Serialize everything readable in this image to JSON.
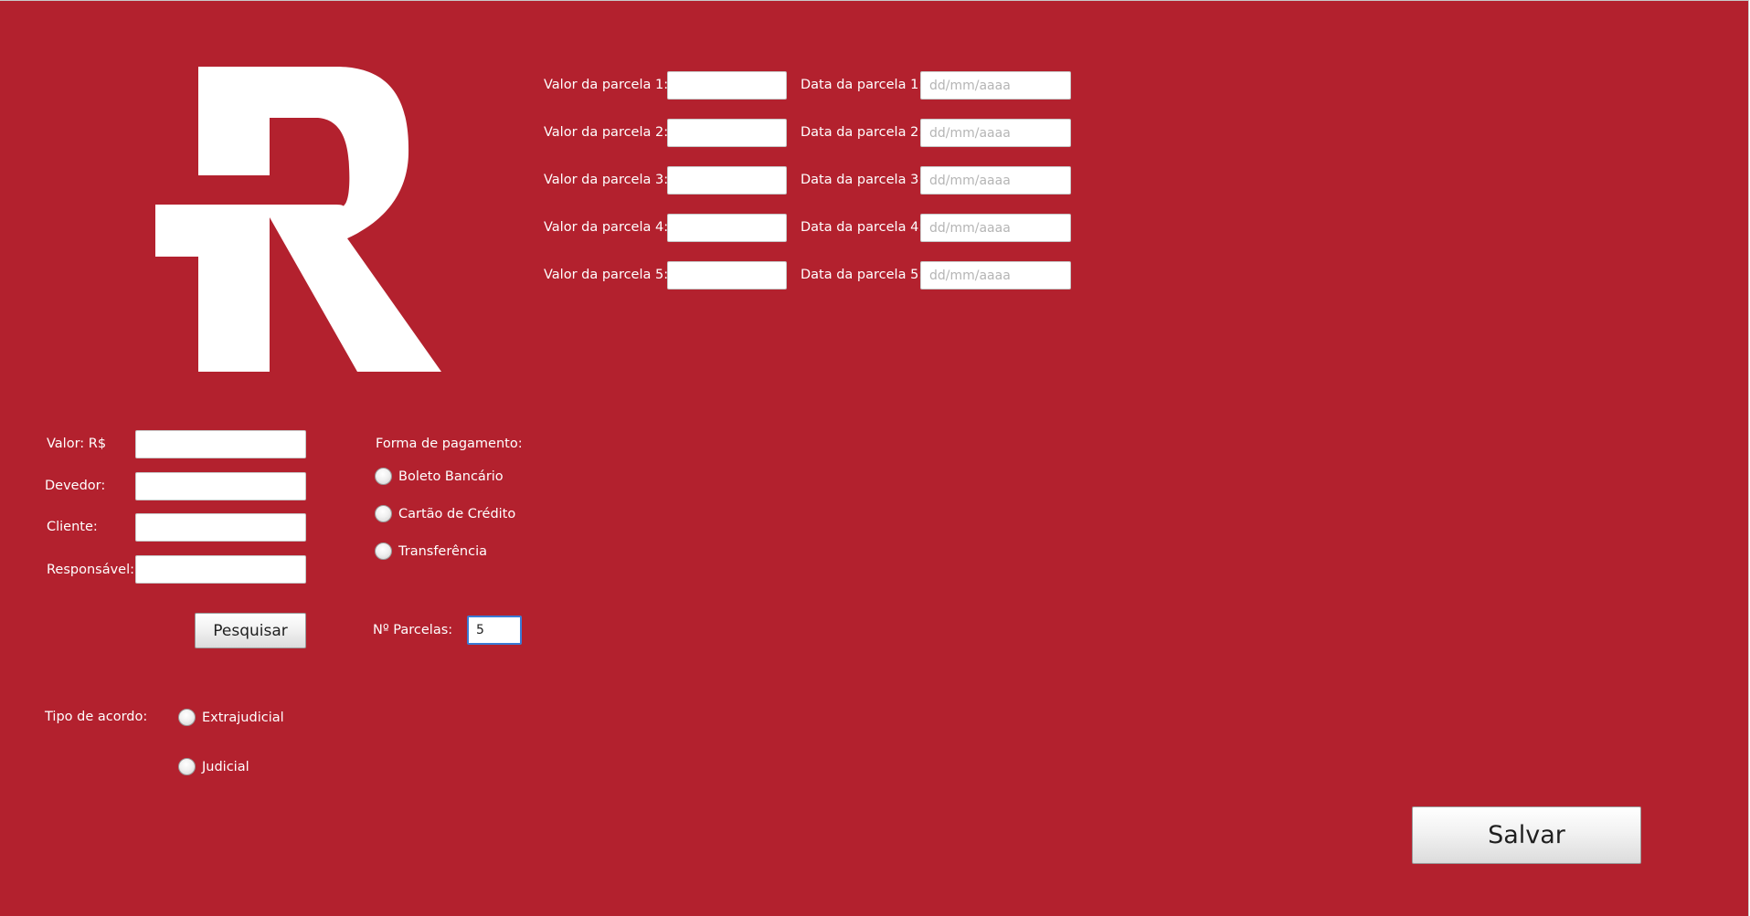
{
  "logo": {
    "letter": "R",
    "color": "#ffffff"
  },
  "installments": {
    "rows": [
      {
        "value_label": "Valor da parcela 1:",
        "value": "",
        "date_label": "Data da parcela 1:",
        "date_placeholder": "dd/mm/aaaa"
      },
      {
        "value_label": "Valor da parcela 2:",
        "value": "",
        "date_label": "Data da parcela 2:",
        "date_placeholder": "dd/mm/aaaa"
      },
      {
        "value_label": "Valor da parcela 3:",
        "value": "",
        "date_label": "Data da parcela 3:",
        "date_placeholder": "dd/mm/aaaa"
      },
      {
        "value_label": "Valor da parcela 4:",
        "value": "",
        "date_label": "Data da parcela 4:",
        "date_placeholder": "dd/mm/aaaa"
      },
      {
        "value_label": "Valor da parcela 5:",
        "value": "",
        "date_label": "Data da parcela 5:",
        "date_placeholder": "dd/mm/aaaa"
      }
    ]
  },
  "form": {
    "valor_label": "Valor: R$",
    "valor_value": "",
    "devedor_label": "Devedor:",
    "devedor_value": "",
    "cliente_label": "Cliente:",
    "cliente_value": "",
    "responsavel_label": "Responsável:",
    "responsavel_value": "",
    "search_label": "Pesquisar"
  },
  "payment": {
    "title": "Forma de pagamento:",
    "options": [
      "Boleto Bancário",
      "Cartão de Crédito",
      "Transferência"
    ],
    "selected": null
  },
  "parcelas": {
    "label": "Nº Parcelas:",
    "value": "5"
  },
  "agreement": {
    "title": "Tipo de acordo:",
    "options": [
      "Extrajudicial",
      "Judicial"
    ],
    "selected": null
  },
  "save_label": "Salvar",
  "colors": {
    "background": "#b3212e",
    "focus": "#3a7bd5",
    "text": "#ffffff"
  }
}
